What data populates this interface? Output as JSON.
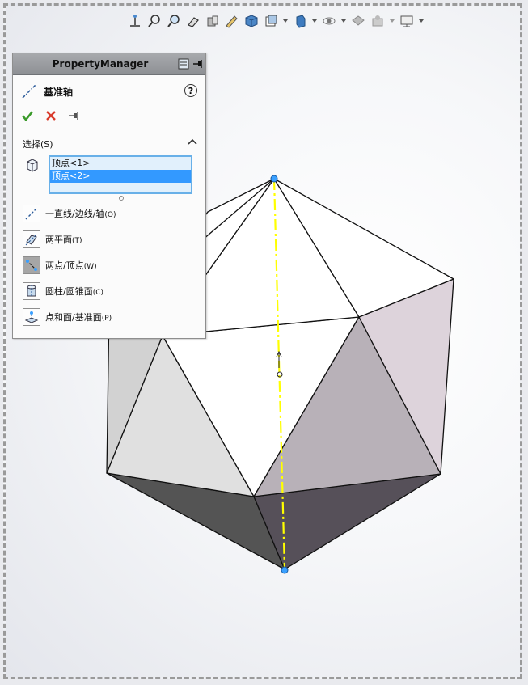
{
  "toolbar": {
    "icons": [
      "view-orientation-icon",
      "zoom-to-fit-icon",
      "zoom-to-area-icon",
      "previous-view-icon",
      "section-view-icon",
      "dynamic-annotation-icon",
      "view-cube-icon",
      "display-style-icon",
      "hide-show-icon",
      "edit-appearance-icon",
      "apply-scene-icon",
      "view-settings-icon"
    ]
  },
  "property_manager": {
    "title": "PropertyManager",
    "feature_name": "基准轴",
    "help": "?",
    "selection": {
      "header": "选择(S)",
      "items": [
        {
          "label": "顶点<1>",
          "selected": false
        },
        {
          "label": "顶点<2>",
          "selected": true
        }
      ]
    },
    "options": [
      {
        "label": "一直线/边线/轴",
        "key": "(O)",
        "active": false,
        "icon": "line-edge-axis-icon"
      },
      {
        "label": "两平面",
        "key": "(T)",
        "active": false,
        "icon": "two-planes-icon"
      },
      {
        "label": "两点/顶点",
        "key": "(W)",
        "active": true,
        "icon": "two-points-icon"
      },
      {
        "label": "圆柱/圆锥面",
        "key": "(C)",
        "active": false,
        "icon": "cylinder-cone-icon"
      },
      {
        "label": "点和面/基准面",
        "key": "(P)",
        "active": false,
        "icon": "point-plane-icon"
      }
    ]
  },
  "colors": {
    "axis": "#ffff00",
    "vertex": "#3aa0ff",
    "accent_selection": "#3399ff",
    "ok": "#3a9a2a",
    "cancel": "#d93a2a"
  }
}
